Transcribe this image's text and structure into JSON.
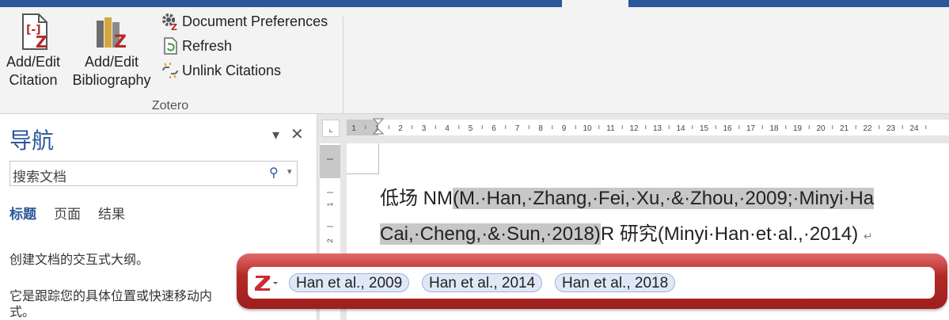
{
  "ribbon": {
    "add_edit_citation": [
      "Add/Edit",
      "Citation"
    ],
    "add_edit_bibliography": [
      "Add/Edit",
      "Bibliography"
    ],
    "document_preferences": "Document Preferences",
    "refresh": "Refresh",
    "unlink_citations": "Unlink Citations",
    "group_label": "Zotero"
  },
  "nav": {
    "title": "导航",
    "search_placeholder": "搜索文档",
    "tabs": [
      "标题",
      "页面",
      "结果"
    ],
    "text1": "创建文档的交互式大纲。",
    "text2": "它是跟踪您的具体位置或快速移动内",
    "text3": "式。"
  },
  "ruler": {
    "marks": [
      "1",
      "1",
      "2",
      "3",
      "4",
      "5",
      "6",
      "7",
      "8",
      "9",
      "10",
      "11",
      "12",
      "13",
      "14",
      "15",
      "16",
      "17",
      "18",
      "19",
      "20",
      "21",
      "22",
      "23",
      "24"
    ],
    "left_marks": [
      "1",
      "2",
      "4"
    ]
  },
  "document": {
    "line1_prefix": "低场 NM",
    "line1_field": "(M.·Han,·Zhang,·Fei,·Xu,·&·Zhou,·2009;·Minyi·Ha",
    "line2_field": "Cai,·Cheng,·&·Sun,·2018)",
    "line2_mid": "R 研究",
    "line2_citation": "(Minyi·Han·et·al.,·2014)",
    "para_mark": "↵"
  },
  "zotero_bar": {
    "citations": [
      "Han et al., 2009",
      "Han et al., 2014",
      "Han et al., 2018"
    ]
  },
  "colors": {
    "accent": "#2b579a",
    "zotero_red": "#b32a27",
    "field_highlight": "#c7c7c7"
  }
}
